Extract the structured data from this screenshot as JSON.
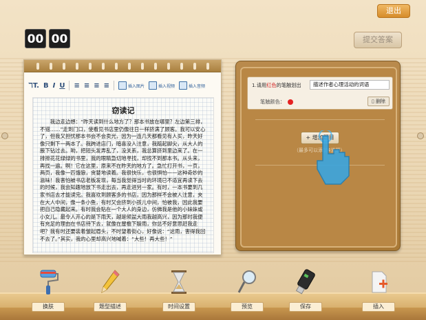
{
  "header": {
    "exit_label": "退出",
    "timer_minutes": "00",
    "timer_seconds": "00",
    "submit_label": "提交答案"
  },
  "editor": {
    "toolbar": {
      "insert_image": "插入图片",
      "insert_video": "插入视频",
      "insert_audio": "插入音频"
    },
    "title": "窃读记",
    "body": "我边走边想：“昨天读到什么地方了？那本书放在哪里？左边第三排，不错……”走到门口，使看见书店里仍像往日一样挤满了顾客。我可以安心了，但我又担忧那本书会不会卖光，因为一连几天都看见有人买，昨天好像只剩下一两本了。我跨进店门，暗喜没人注意，我踮起脚尖，从大人的腋下钻过去。哟，把短头发弄乱了，没关系，我总算挤到里边来了。在一排排花花绿绿的书里，我的眼睛急切地寻找，却找不到那本书。从头来，再找一遍。啊！它在这里，原来不在昨天的地方了。急忙打开书，一页，两页，我像一匹饿狼，贪婪地读着。我很快乐，也很惧怕——这种奇妙的滋味！我害怕被书店老板发现，每当我觉得当时的环境已不适宜再读下去的时候，我会知趣地放下书走出去，再走进另一家。有时，一本书要到几家书店去才能读完。我喜欢到顾客多的书店，因为那样不会被人注意，夹在大人中间，像一条小鱼，有时又会挤到小孩儿中间，怕被我，因此我要把自己隐藏起来。有时我会贴在一个大人的身边，仿佛我是他的小妹妹或小女儿。最令人开心的是下雨天，越是倾盆大雨我越高兴，因为那时我便有充足的理由在书店待下去，就像在屋檐下躲雨，你总不好意思赶我走吧？我有时还要装着皱起眉头，不时望着街心，好像说：“这雨，害得我回不去了。”其实，我的心里却高兴地喊着：“大些！再大些！”"
  },
  "panel": {
    "question_label_pre": "1.请用",
    "question_label_color": "红色",
    "question_label_post": "的笔触划出",
    "question_value": "描述作者心理活动的词语",
    "pen_color_label": "笔触颜色：",
    "pen_color": "#e52222",
    "delete_label": "删除",
    "add_label": "增加题目",
    "add_hint": "（最多可以添加4道题）"
  },
  "bottom_tools": [
    {
      "label": "换肤",
      "icon": "paint-roller-icon"
    },
    {
      "label": "题型描述",
      "icon": "pencil-icon"
    },
    {
      "label": "时间设置",
      "icon": "hourglass-icon"
    },
    {
      "label": "预览",
      "icon": "magnifier-icon"
    },
    {
      "label": "保存",
      "icon": "usb-drive-icon"
    },
    {
      "label": "插入",
      "icon": "insert-doc-icon"
    }
  ]
}
